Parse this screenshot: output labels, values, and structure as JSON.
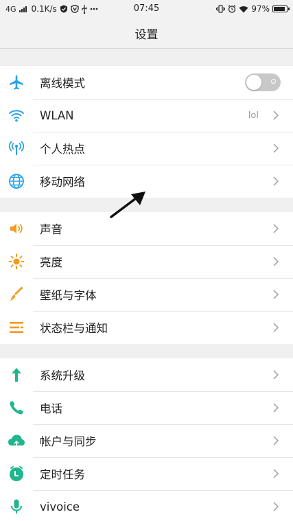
{
  "status_bar": {
    "network": "4G",
    "speed": "0.1K/s",
    "time": "07:45",
    "battery": "97%",
    "battery_level": 0.97,
    "left_icons": [
      "signal-icon",
      "shield-icon",
      "vpn-icon",
      "usb-icon",
      "more-icon"
    ],
    "right_icons": [
      "vibrate-icon",
      "alarm-icon",
      "wifi-icon",
      "battery-icon"
    ]
  },
  "header": {
    "title": "设置"
  },
  "groups": [
    {
      "items": [
        {
          "label": "离线模式",
          "icon": "airplane-icon",
          "color": "#2aa3e6",
          "control": "toggle",
          "toggle_on": false
        },
        {
          "label": "WLAN",
          "icon": "wifi-icon",
          "color": "#2aa3e6",
          "value": "lol",
          "control": "chevron"
        },
        {
          "label": "个人热点",
          "icon": "hotspot-icon",
          "color": "#2aa3e6",
          "control": "chevron"
        },
        {
          "label": "移动网络",
          "icon": "globe-icon",
          "color": "#2aa3e6",
          "control": "chevron"
        }
      ]
    },
    {
      "items": [
        {
          "label": "声音",
          "icon": "speaker-icon",
          "color": "#f39a1e",
          "control": "chevron"
        },
        {
          "label": "亮度",
          "icon": "brightness-icon",
          "color": "#f39a1e",
          "control": "chevron"
        },
        {
          "label": "壁纸与字体",
          "icon": "brush-icon",
          "color": "#f39a1e",
          "control": "chevron"
        },
        {
          "label": "状态栏与通知",
          "icon": "notification-list-icon",
          "color": "#f39a1e",
          "control": "chevron"
        }
      ]
    },
    {
      "items": [
        {
          "label": "系统升级",
          "icon": "upgrade-arrow-icon",
          "color": "#1fb58d",
          "control": "chevron"
        },
        {
          "label": "电话",
          "icon": "phone-icon",
          "color": "#1fb58d",
          "control": "chevron"
        },
        {
          "label": "帐户与同步",
          "icon": "cloud-sync-icon",
          "color": "#1fb58d",
          "control": "chevron"
        },
        {
          "label": "定时任务",
          "icon": "timer-icon",
          "color": "#1fb58d",
          "control": "chevron"
        },
        {
          "label": "vivoice",
          "icon": "microphone-icon",
          "color": "#1fb58d",
          "control": "chevron"
        }
      ]
    }
  ],
  "annotation": {
    "icon": "pointer-arrow-icon",
    "color": "#111111"
  }
}
